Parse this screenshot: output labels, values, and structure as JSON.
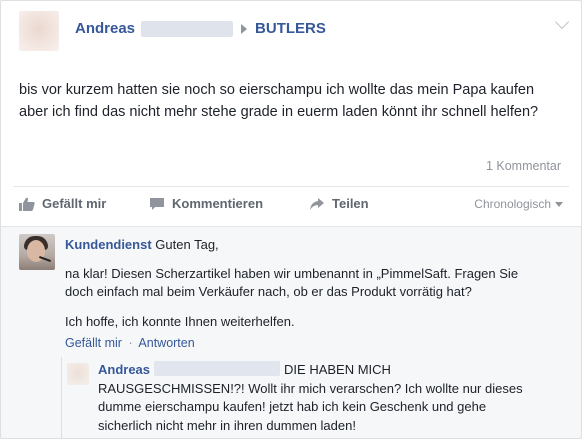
{
  "post": {
    "author": "Andreas",
    "page": "BUTLERS",
    "text": "bis vor kurzem hatten sie noch so eierschampu ich wollte das mein Papa kaufen aber ich find das nicht mehr stehe grade in euerm laden könnt ihr schnell helfen?",
    "comment_count": "1 Kommentar"
  },
  "actions": {
    "like": "Gefällt mir",
    "comment": "Kommentieren",
    "share": "Teilen",
    "sort": "Chronologisch"
  },
  "comment1": {
    "author": "Kundendienst",
    "greeting": "Guten Tag,",
    "paragraph1": "na klar! Diesen Scherzartikel haben wir umbenannt in „PimmelSaft. Fragen Sie doch einfach mal beim Verkäufer nach, ob er das Produkt vorrätig hat?",
    "paragraph2": "Ich hoffe, ich konnte Ihnen weiterhelfen.",
    "like_link": "Gefällt mir",
    "separator": "·",
    "reply_link": "Antworten"
  },
  "reply1": {
    "author": "Andreas",
    "text": "DIE HABEN MICH RAUSGESCHMISSEN!?! Wollt ihr mich verarschen? Ich wollte nur dieses dumme eierschampu kaufen! jetzt hab ich kein Geschenk und gehe sicherlich nicht mehr in ihren dummen laden!"
  }
}
